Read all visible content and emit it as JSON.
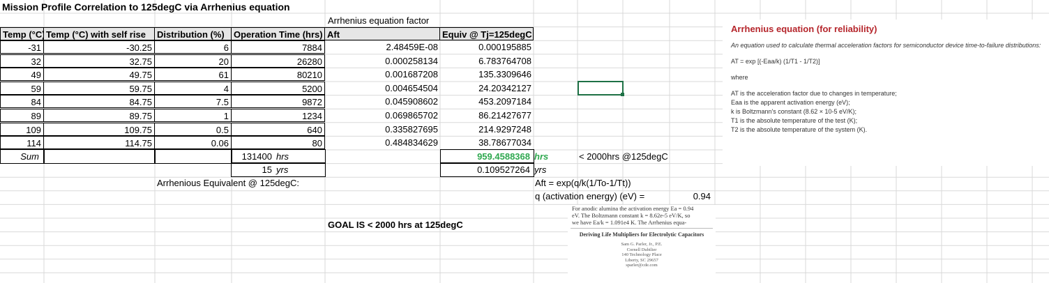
{
  "sheet": {
    "title": "Mission Profile Correlation to 125degC via Arrhenius equation",
    "arr_factor_label": "Arrhenius equation factor",
    "headers": [
      "Temp (°C)",
      "Temp (°C) with self rise",
      "Distribution (%)",
      "Operation Time (hrs)",
      "Aft",
      "Equiv @ Tj=125degC"
    ],
    "rows": [
      [
        "-31",
        "-30.25",
        "6",
        "7884",
        "2.48459E-08",
        "0.000195885"
      ],
      [
        "32",
        "32.75",
        "20",
        "26280",
        "0.000258134",
        "6.783764708"
      ],
      [
        "49",
        "49.75",
        "61",
        "80210",
        "0.001687208",
        "135.3309646"
      ],
      [
        "59",
        "59.75",
        "4",
        "5200",
        "0.004654504",
        "24.20342127"
      ],
      [
        "84",
        "84.75",
        "7.5",
        "9872",
        "0.045908602",
        "453.2097184"
      ],
      [
        "89",
        "89.75",
        "1",
        "1234",
        "0.069865702",
        "86.21427677"
      ],
      [
        "109",
        "109.75",
        "0.5",
        "640",
        "0.335827695",
        "214.9297248"
      ],
      [
        "114",
        "114.75",
        "0.06",
        "80",
        "0.484834629",
        "38.78677034"
      ]
    ],
    "sum_label": "Sum",
    "sum_hrs": "131400",
    "unit_hrs": "hrs",
    "sum_yrs": "15",
    "unit_yrs": "yrs",
    "equiv_total": "959.4588368",
    "equiv_hrs_unit": "hrs",
    "target_note": "< 2000hrs @125degC",
    "equiv_yrs": "0.109527264",
    "equiv_yrs_unit": "yrs",
    "arr_equiv_label": "Arrhenious Equivalent @ 125degC:",
    "aft_formula": "Aft = exp(q/k(1/To-1/Tt))",
    "q_label": "q (activation energy) (eV) =",
    "q_value": "0.94",
    "goal": "GOAL IS < 2000 hrs at 125degC",
    "accent_green": "#2fa84f"
  },
  "info_box": {
    "heading": "Arrhenius equation (for reliability)",
    "intro": "An equation used to calculate thermal acceleration factors for semiconductor device time-to-failure distributions:",
    "formula": "AT = exp [(-Eaa/k) (1/T1 - 1/T2)]",
    "where": "where",
    "defs": [
      "AT is the acceleration factor due to changes in temperature;",
      "Eaa is the apparent activation energy (eV);",
      "k is Boltzmann's constant (8.62 × 10-5 eV/K);",
      "T1 is the absolute temperature of the test (K);",
      "T2 is the absolute temperature of the system (K)."
    ],
    "heading_color": "#b5252b"
  },
  "paper": {
    "lines": [
      "For anodic alumina the activation energy Ea = 0.94",
      "eV. The Boltzmann constant k = 8.62e-5 eV/K, so",
      "we have Ea/k = 1.091e4 K. The Arrhenius equa-"
    ],
    "title": "Deriving Life Multipliers for Electrolytic Capacitors",
    "author": [
      "Sam G. Parler, Jr., P.E.",
      "Cornell Dubilier",
      "140 Technology Place",
      "Liberty, SC 29657",
      "sparler@cde.com"
    ]
  }
}
